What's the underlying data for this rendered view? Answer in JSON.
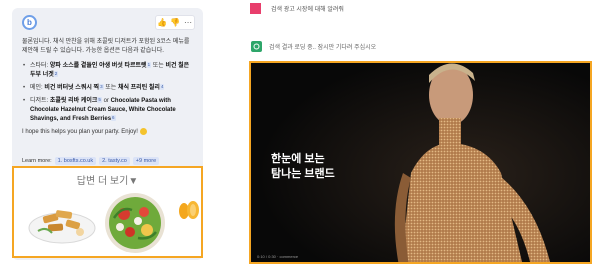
{
  "chat": {
    "bot_logo": "b",
    "actions": [
      {
        "name": "thumbs-up-icon",
        "glyph": "👍"
      },
      {
        "name": "thumbs-down-icon",
        "glyph": "👎"
      },
      {
        "name": "more-icon",
        "glyph": "⋯"
      }
    ],
    "intro": "물론입니다. 채식 만찬을 위해 초콜릿 디저트가 포함된 3코스 메뉴를 제안해 드릴 수 있습니다. 가능한 옵션은 다음과 같습니다.",
    "menu": [
      {
        "prefix": "스타터: ",
        "bold": "양파 소스를 곁들인 야생 버섯 타르트렛",
        "mid": " 또는 ",
        "bold2": "비건 칠은 두부 너겟"
      },
      {
        "prefix": "메인: ",
        "bold": "비건 버터넛 스쿼시 찍",
        "mid": " 또는 ",
        "bold2": "채식 프리틴 칠리"
      },
      {
        "prefix": "디저트: ",
        "bold": "초콜릿 리바 케이크",
        "mid": " or ",
        "bold2": "Chocolate Pasta with Chocolate Hazelnut Cream Sauce, White Chocolate Shavings, and Fresh Berries"
      }
    ],
    "cite_marks": [
      "1",
      "2",
      "3",
      "4",
      "5",
      "6"
    ],
    "closing": "I hope this helps you plan your party. Enjoy!",
    "learn_more_label": "Learn more:",
    "sources": [
      "1. bosfts.co.uk",
      "2. tasty.co",
      "+9 more"
    ],
    "more_title": "답변 더 보기▼"
  },
  "ad_panel": {
    "ad_link": "검색 광고 시장에 대해 알려줘",
    "loading": "검색 결과 로딩 중.. 잠시만 기다려 주십시오",
    "video_caption_line1": "한눈에 보는",
    "video_caption_line2": "탐나는 브랜드",
    "video_footer": "0:10 / 0:30 · commerce"
  },
  "colors": {
    "accent_orange": "#f5a623",
    "ad_pink": "#e83e6c",
    "bing_green": "#2ea66a",
    "cite_blue": "#3d5ea8"
  }
}
